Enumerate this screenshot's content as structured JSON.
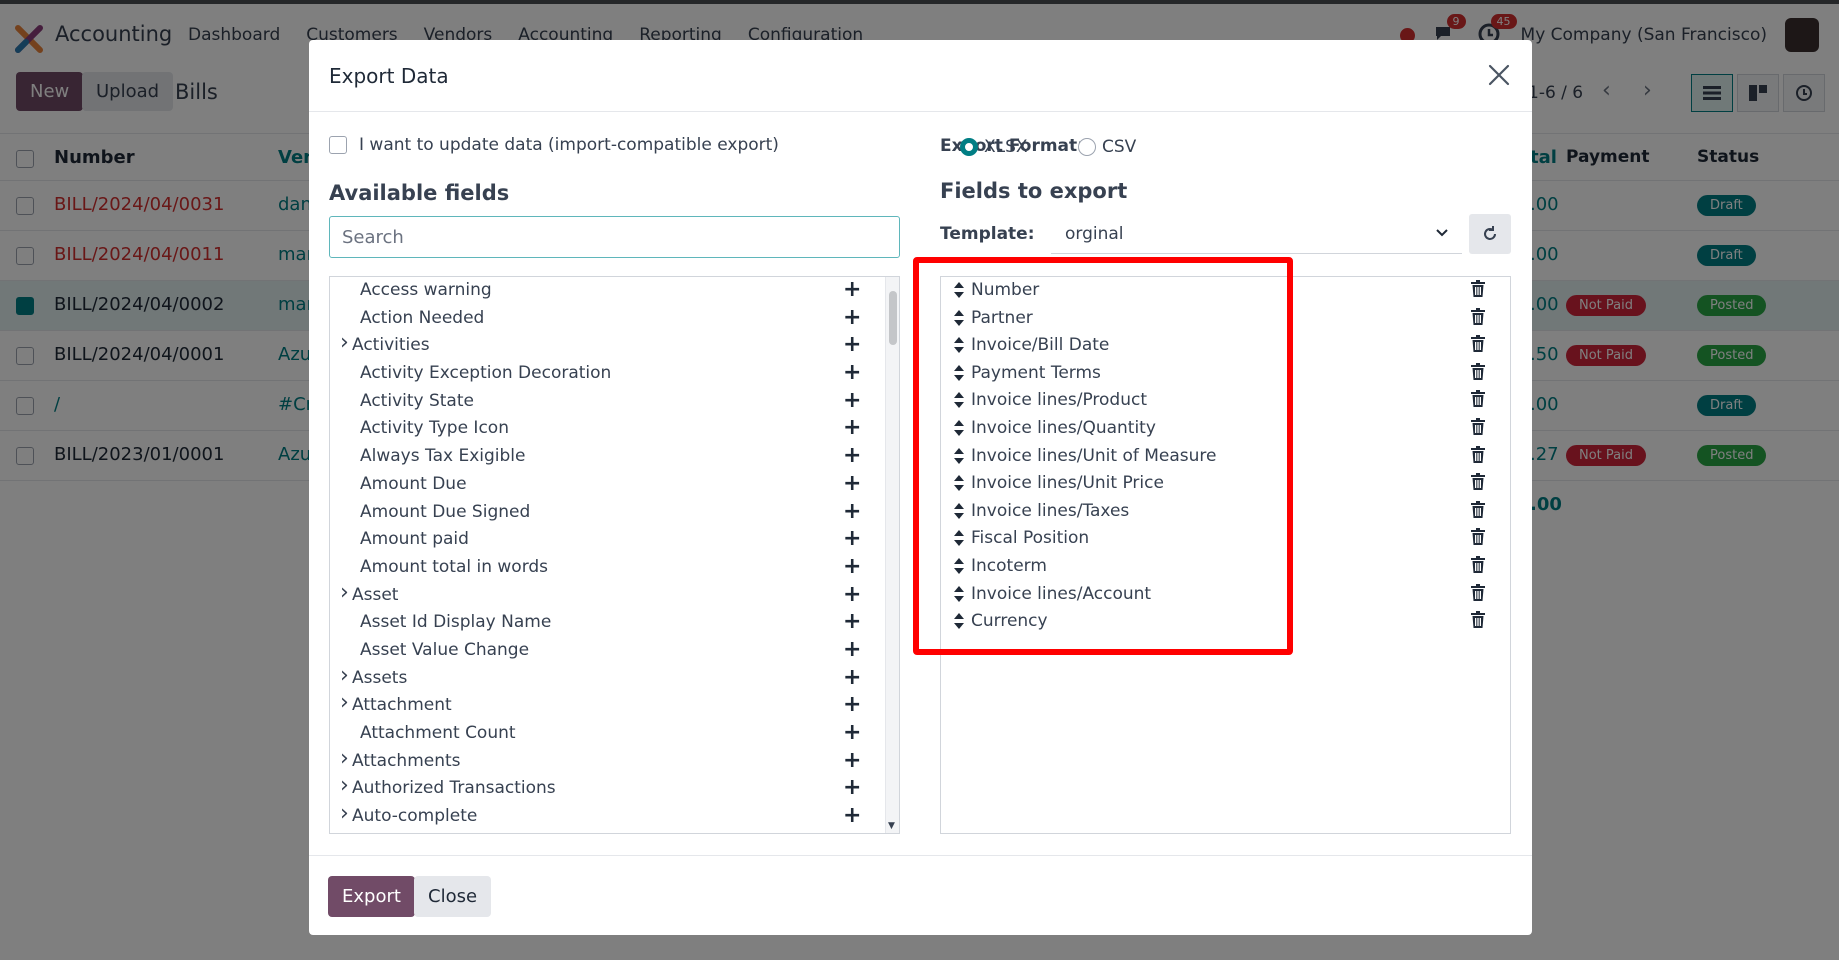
{
  "app": {
    "name": "Accounting",
    "nav": [
      "Dashboard",
      "Customers",
      "Vendors",
      "Accounting",
      "Reporting",
      "Configuration"
    ],
    "messages_badge": "9",
    "activity_badge": "45",
    "company": "My Company (San Francisco)"
  },
  "control": {
    "new_label": "New",
    "upload_label": "Upload",
    "breadcrumb": "Bills",
    "pager": "1-6 / 6"
  },
  "list": {
    "headers": {
      "number": "Number",
      "vendor": "Ven",
      "total": "tal",
      "payment": "Payment",
      "status": "Status"
    },
    "rows": [
      {
        "number": "BILL/2024/04/0031",
        "vendor": "dan",
        "total": ".00",
        "payment": "",
        "status": "Draft"
      },
      {
        "number": "BILL/2024/04/0011",
        "vendor": "mar",
        "total": ".00",
        "payment": "",
        "status": "Draft"
      },
      {
        "number": "BILL/2024/04/0002",
        "vendor": "mar",
        "total": ".00",
        "payment": "Not Paid",
        "status": "Posted"
      },
      {
        "number": "BILL/2024/04/0001",
        "vendor": "Azu",
        "total": ".50",
        "payment": "Not Paid",
        "status": "Posted"
      },
      {
        "number": "/",
        "vendor": "#Cr",
        "total": ".00",
        "payment": "",
        "status": "Draft"
      },
      {
        "number": "BILL/2023/01/0001",
        "vendor": "Azu",
        "total": ".27",
        "payment": "Not Paid",
        "status": "Posted"
      }
    ],
    "sum": ".00"
  },
  "modal": {
    "title": "Export Data",
    "import_compat_label": "I want to update data (import-compatible export)",
    "available_heading": "Available fields",
    "search_placeholder": "Search",
    "export_format_label": "Export Format:",
    "format_xlsx": "XLSX",
    "format_csv": "CSV",
    "fields_heading": "Fields to export",
    "template_label": "Template:",
    "template_value": "orginal",
    "export_button": "Export",
    "close_button": "Close"
  },
  "available_fields": [
    {
      "label": "Access warning",
      "expandable": false
    },
    {
      "label": "Action Needed",
      "expandable": false
    },
    {
      "label": "Activities",
      "expandable": true
    },
    {
      "label": "Activity Exception Decoration",
      "expandable": false
    },
    {
      "label": "Activity State",
      "expandable": false
    },
    {
      "label": "Activity Type Icon",
      "expandable": false
    },
    {
      "label": "Always Tax Exigible",
      "expandable": false
    },
    {
      "label": "Amount Due",
      "expandable": false
    },
    {
      "label": "Amount Due Signed",
      "expandable": false
    },
    {
      "label": "Amount paid",
      "expandable": false
    },
    {
      "label": "Amount total in words",
      "expandable": false
    },
    {
      "label": "Asset",
      "expandable": true
    },
    {
      "label": "Asset Id Display Name",
      "expandable": false
    },
    {
      "label": "Asset Value Change",
      "expandable": false
    },
    {
      "label": "Assets",
      "expandable": true
    },
    {
      "label": "Attachment",
      "expandable": true
    },
    {
      "label": "Attachment Count",
      "expandable": false
    },
    {
      "label": "Attachments",
      "expandable": true
    },
    {
      "label": "Authorized Transactions",
      "expandable": true
    },
    {
      "label": "Auto-complete",
      "expandable": true
    }
  ],
  "export_fields": [
    "Number",
    "Partner",
    "Invoice/Bill Date",
    "Payment Terms",
    "Invoice lines/Product",
    "Invoice lines/Quantity",
    "Invoice lines/Unit of Measure",
    "Invoice lines/Unit Price",
    "Invoice lines/Taxes",
    "Fiscal Position",
    "Incoterm",
    "Invoice lines/Account",
    "Currency"
  ],
  "colors": {
    "brand": "#714b67",
    "accent": "#017e84",
    "highlight": "#ff0000"
  }
}
